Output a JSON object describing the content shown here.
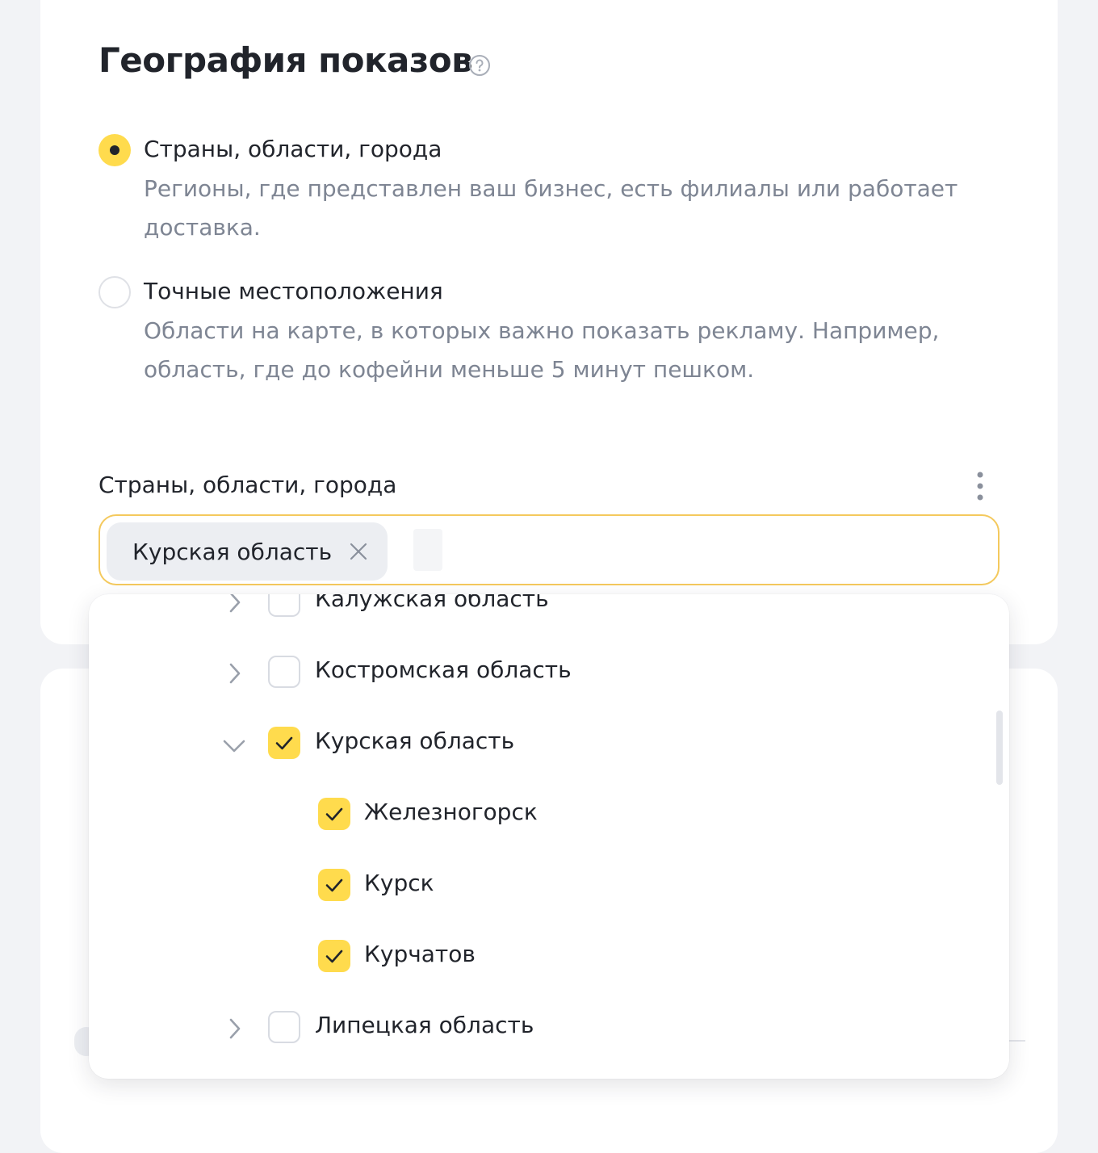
{
  "page": {
    "title": "География показов",
    "help_icon": "question-circle-icon"
  },
  "targeting_mode": {
    "options": [
      {
        "label": "Страны, области, города",
        "description": "Регионы, где представлен ваш бизнес, есть филиалы или работает доставка.",
        "selected": true
      },
      {
        "label": "Точные местоположения",
        "description": "Области на карте, в которых важно показать рекламу. Например, область, где до кофейни меньше 5 минут пешком.",
        "selected": false
      }
    ]
  },
  "regions_field": {
    "label": "Страны, области, города",
    "more_icon": "more-vertical-icon",
    "chips": [
      {
        "label": "Курская область",
        "remove_icon": "close-icon"
      }
    ]
  },
  "dropdown": {
    "items": [
      {
        "label": "Калужская область",
        "checked": false,
        "expanded": false,
        "level": 0
      },
      {
        "label": "Костромская область",
        "checked": false,
        "expanded": false,
        "level": 0
      },
      {
        "label": "Курская область",
        "checked": true,
        "expanded": true,
        "level": 0
      },
      {
        "label": "Железногорск",
        "checked": true,
        "level": 1
      },
      {
        "label": "Курск",
        "checked": true,
        "level": 1
      },
      {
        "label": "Курчатов",
        "checked": true,
        "level": 1
      },
      {
        "label": "Липецкая область",
        "checked": false,
        "expanded": false,
        "level": 0
      }
    ]
  },
  "colors": {
    "accent": "#ffdb4d",
    "focus_border": "#f4c95d",
    "text": "#21242b",
    "muted_text": "#7e8593"
  }
}
